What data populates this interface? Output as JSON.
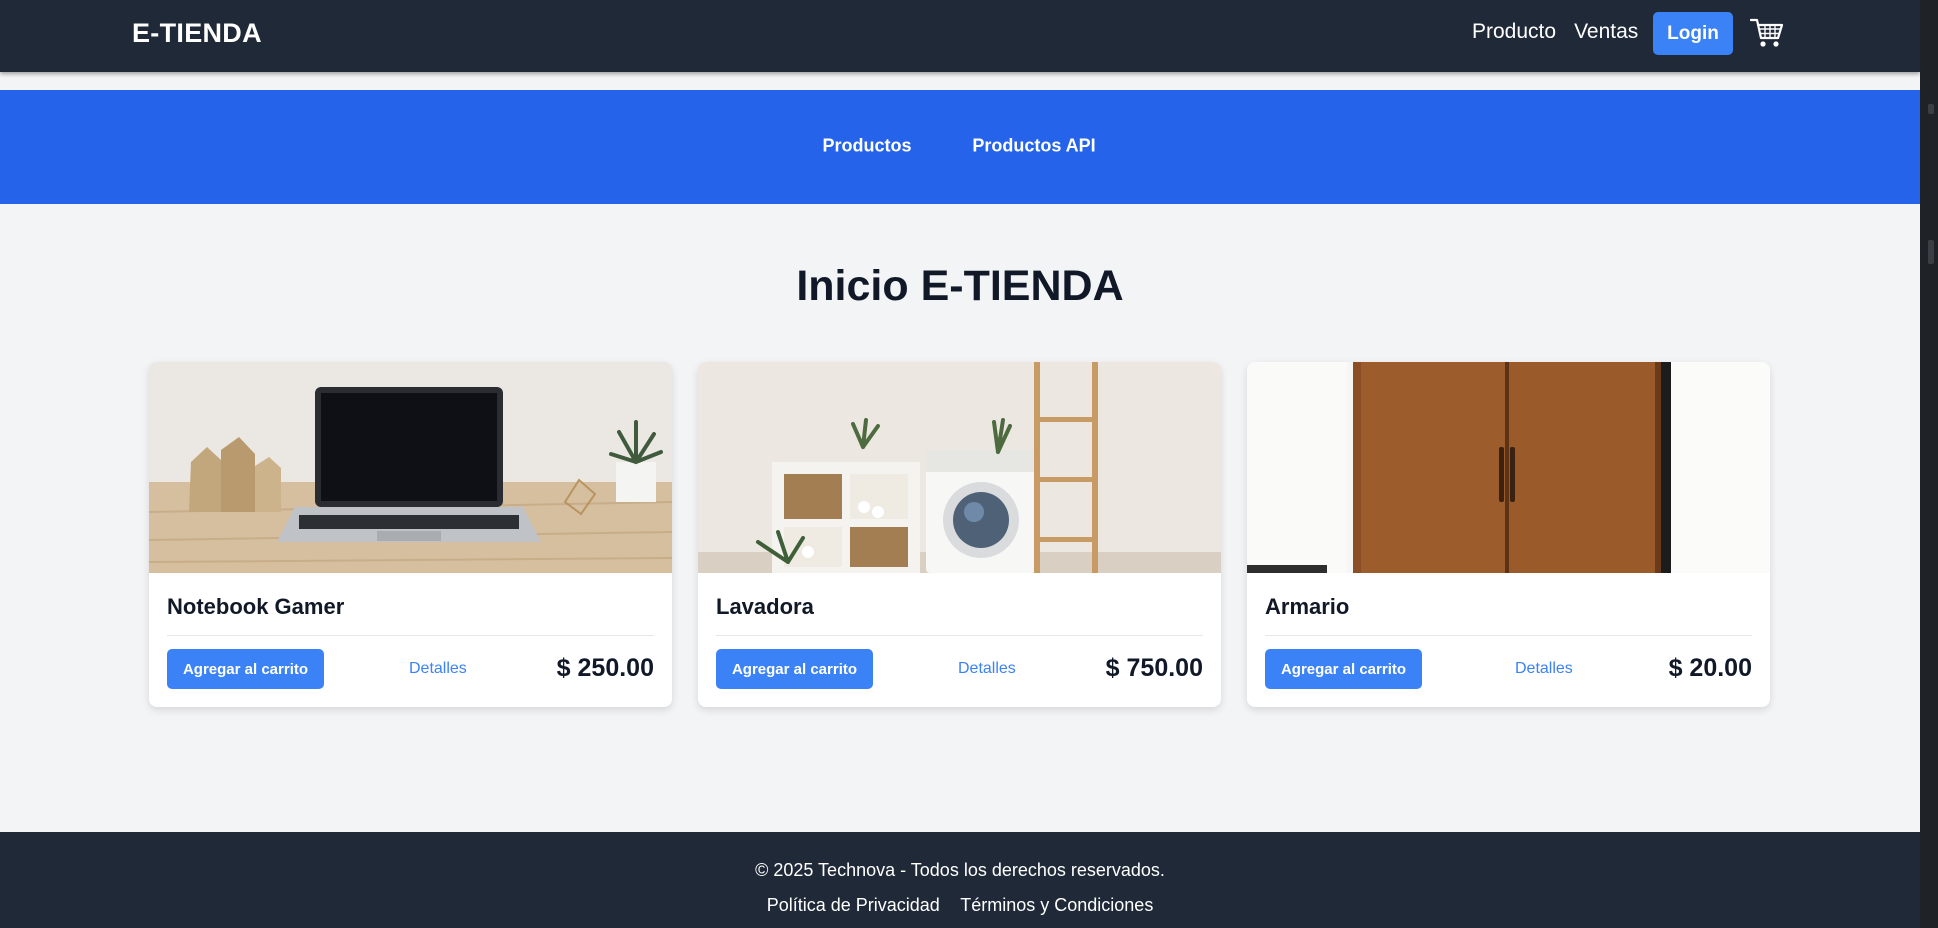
{
  "navbar": {
    "brand": "E-TIENDA",
    "links": [
      "Producto",
      "Ventas"
    ],
    "login_label": "Login",
    "cart_icon": "shopping-cart-icon"
  },
  "subnav": {
    "links": [
      "Productos",
      "Productos API"
    ]
  },
  "main": {
    "title": "Inicio E-TIENDA"
  },
  "products": [
    {
      "name": "Notebook Gamer",
      "add_label": "Agregar al carrito",
      "details_label": "Detalles",
      "price": "$ 250.00",
      "image": "laptop-on-desk-photo"
    },
    {
      "name": "Lavadora",
      "add_label": "Agregar al carrito",
      "details_label": "Detalles",
      "price": "$ 750.00",
      "image": "washing-machine-laundry-photo"
    },
    {
      "name": "Armario",
      "add_label": "Agregar al carrito",
      "details_label": "Detalles",
      "price": "$ 20.00",
      "image": "wooden-wardrobe-photo"
    }
  ],
  "footer": {
    "copyright": "© 2025 Technova - Todos los derechos reservados.",
    "links": [
      "Política de Privacidad",
      "Términos y Condiciones"
    ]
  },
  "colors": {
    "navbar": "#1f2937",
    "primary": "#2563eb",
    "button": "#3b82f6",
    "page_bg": "#f3f4f6"
  }
}
